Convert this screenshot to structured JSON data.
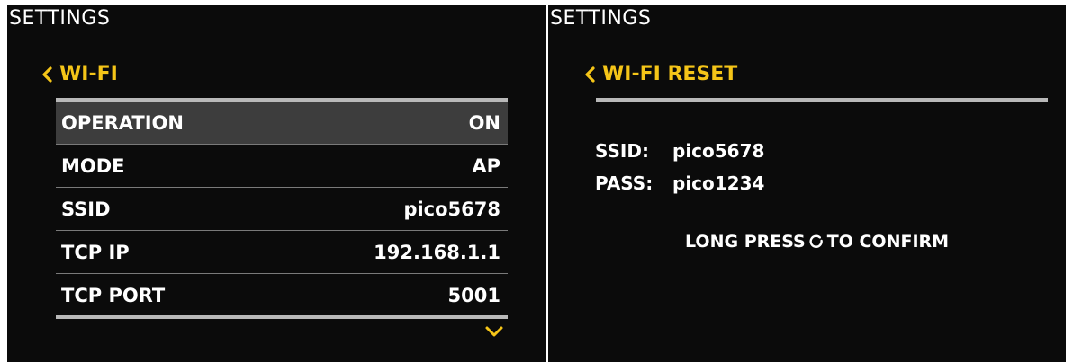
{
  "left_screen": {
    "title": "SETTINGS",
    "back_label": "WI-FI",
    "rows": [
      {
        "label": "OPERATION",
        "value": "ON",
        "selected": true
      },
      {
        "label": "MODE",
        "value": "AP",
        "selected": false
      },
      {
        "label": "SSID",
        "value": "pico5678",
        "selected": false
      },
      {
        "label": "TCP IP",
        "value": "192.168.1.1",
        "selected": false
      },
      {
        "label": "TCP PORT",
        "value": "5001",
        "selected": false
      }
    ]
  },
  "right_screen": {
    "title": "SETTINGS",
    "back_label": "WI-FI RESET",
    "ssid_key": "SSID:",
    "ssid_value": "pico5678",
    "pass_key": "PASS:",
    "pass_value": "pico1234",
    "confirm_before": "LONG PRESS",
    "confirm_after": "TO CONFIRM"
  },
  "icons": {
    "back": "chevron-left-icon",
    "more": "chevron-down-icon",
    "button": "round-button-icon"
  },
  "colors": {
    "screen_bg": "#0b0b0b",
    "accent": "#f5c518",
    "selected_row_bg": "#3d3d3d",
    "rule": "#b9b9b9",
    "text": "#ffffff"
  }
}
